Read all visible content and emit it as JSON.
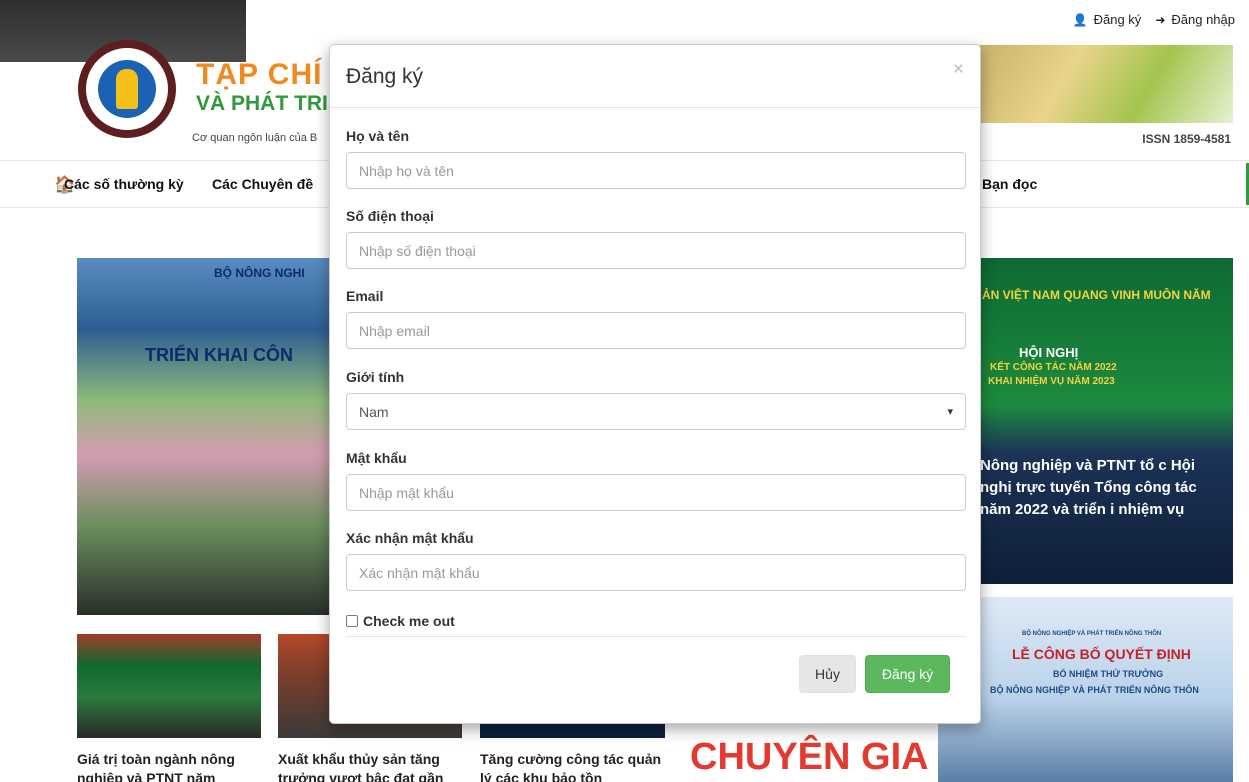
{
  "topbar": {
    "register_icon": "user-plus-icon",
    "register_label": "Đăng ký",
    "login_icon": "sign-in-icon",
    "login_label": "Đăng nhập"
  },
  "header": {
    "title_line1": "TẠP CHÍ",
    "title_line2": "VÀ PHÁT TRI",
    "subtitle": "Cơ quan ngôn luận của B",
    "issn": "ISSN 1859-4581"
  },
  "nav": {
    "home_icon": "home-icon",
    "items": [
      "Các số thường kỳ",
      "Các Chuyên đề",
      "Bạn đọc"
    ]
  },
  "content": {
    "hero_left_line1": "BỘ NÔNG NGHI",
    "hero_left_line2": "TRIỂN KHAI CÔN",
    "hero_right_banner": "ẢN VIỆT NAM QUANG VINH MUÔN NĂM",
    "hero_right_meeting1": "HỘI NGHỊ",
    "hero_right_meeting2": "KẾT CÔNG TÁC NĂM 2022",
    "hero_right_meeting3": "KHAI NHIỆM VỤ NĂM 2023",
    "hero_right_title": "Nông nghiệp và PTNT tổ c Hội nghị trực tuyến Tổng công tác năm 2022 và triển i nhiệm vụ",
    "side_ministry": "BỘ NÔNG NGHIỆP VÀ PHÁT TRIỂN NÔNG THÔN",
    "side_title1": "LỄ CÔNG BỐ QUYẾT ĐỊNH",
    "side_title2": "BỔ NHIỆM THỨ TRƯỞNG",
    "side_title3": "BỘ NÔNG NGHIỆP VÀ PHÁT TRIỂN NÔNG THÔN",
    "chuyen_gia": "CHUYÊN GIA",
    "articles": [
      "Giá trị toàn ngành nông nghiệp và PTNT năm",
      "Xuất khẩu thủy sản tăng trưởng vượt bậc đạt gần",
      "Tăng cường công tác quản lý các khu bảo tồn"
    ]
  },
  "modal": {
    "title": "Đăng ký",
    "close_label": "×",
    "fields": {
      "name_label": "Họ và tên",
      "name_placeholder": "Nhập họ và tên",
      "phone_label": "Số điện thoại",
      "phone_placeholder": "Nhập số điện thoại",
      "email_label": "Email",
      "email_placeholder": "Nhập email",
      "gender_label": "Giới tính",
      "gender_value": "Nam",
      "password_label": "Mật khẩu",
      "password_placeholder": "Nhập mật khẩu",
      "confirm_label": "Xác nhận mật khẩu",
      "confirm_placeholder": "Xác nhận mật khẩu"
    },
    "check_label": "Check me out",
    "cancel_label": "Hủy",
    "submit_label": "Đăng ký"
  }
}
